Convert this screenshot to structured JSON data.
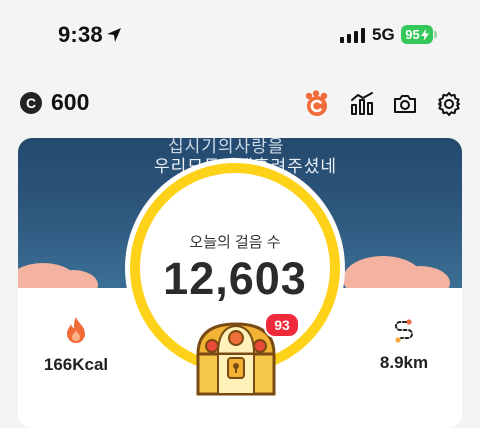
{
  "status_bar": {
    "time": "9:38",
    "network": "5G",
    "battery": "95"
  },
  "header": {
    "coin_balance": "600",
    "coin_symbol": "C",
    "icons": [
      "pet-paw-icon",
      "stats-icon",
      "camera-icon",
      "settings-gear-icon"
    ]
  },
  "banner": {
    "line1": "십시기의사랑을",
    "line2": "우리모두에게흘려주셨네"
  },
  "steps": {
    "label": "오늘의 걸음 수",
    "value": "12,603"
  },
  "stats": {
    "calories": "166Kcal",
    "distance": "8.9km"
  },
  "reward": {
    "badge_count": "93"
  },
  "colors": {
    "ring": "#ffd21a",
    "accent_orange": "#f26b3a",
    "badge_red": "#ef2a3a",
    "battery_green": "#34c759",
    "banner_blue": "#2d567c"
  }
}
